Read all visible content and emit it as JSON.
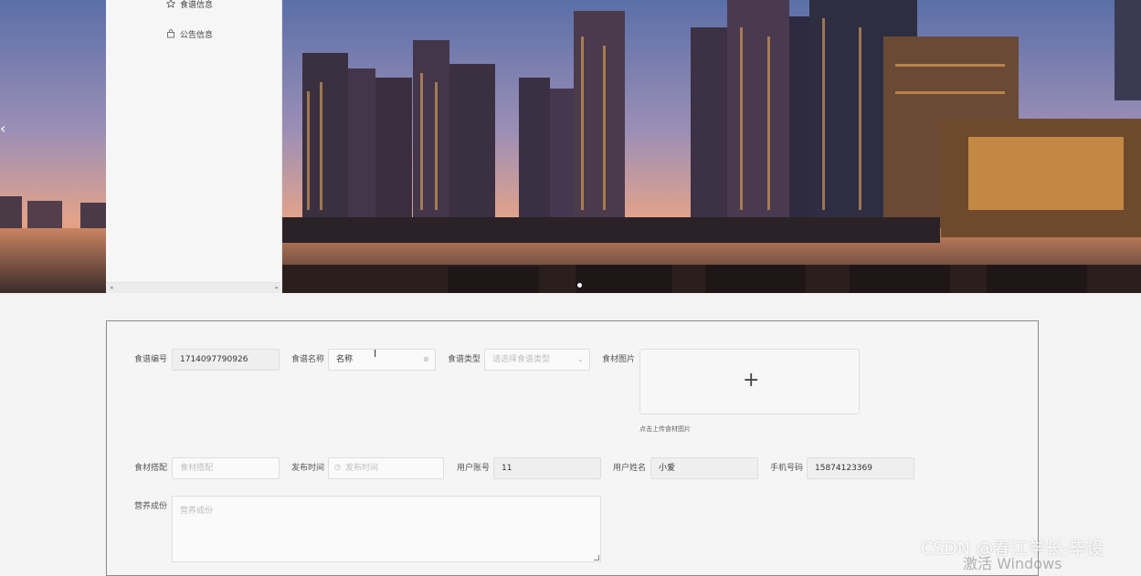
{
  "sidebar": {
    "items": [
      {
        "label": "食谱信息",
        "icon": "star-icon"
      },
      {
        "label": "公告信息",
        "icon": "bag-icon"
      }
    ]
  },
  "banner": {
    "prev_arrow": "‹"
  },
  "form": {
    "recipe_no": {
      "label": "食谱编号",
      "value": "1714097790926"
    },
    "recipe_name": {
      "label": "食谱名称",
      "value": "名称"
    },
    "recipe_type": {
      "label": "食谱类型",
      "placeholder": "请选择食谱类型"
    },
    "ingredient_image": {
      "label": "食材图片",
      "tip": "点击上传食材图片"
    },
    "ingredients": {
      "label": "食材搭配",
      "placeholder": "食材搭配"
    },
    "publish_time": {
      "label": "发布时间",
      "placeholder": "发布时间"
    },
    "user_account": {
      "label": "用户账号",
      "value": "11"
    },
    "user_name": {
      "label": "用户姓名",
      "value": "小爱"
    },
    "phone": {
      "label": "手机号码",
      "value": "15874123369"
    },
    "nutrition": {
      "label": "营养成份",
      "placeholder": "营养成份"
    }
  },
  "overlay": {
    "watermark": "CSDN @春江学长-毕设",
    "activate": "激活 Windows"
  }
}
